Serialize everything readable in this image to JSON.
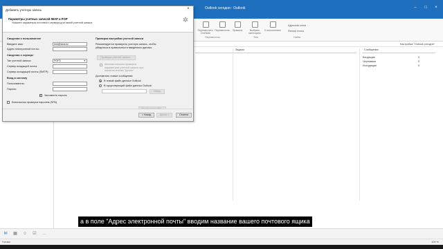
{
  "outlook": {
    "title": "Outlook сегодня - Outlook",
    "ribbon": {
      "items": [
        "Переместить: OneNote",
        "Правила",
        "Переместить",
        "Выбрать категорию",
        "К исполнению"
      ],
      "small": [
        "Адресная книга",
        "Фильтр почты"
      ],
      "groups": [
        "Переместить",
        "Теги",
        "Найти"
      ]
    },
    "subbar_right": "Настройка \"Outlook сегодня\"",
    "columns": {
      "tasks": "Задачи",
      "messages": "Сообщения"
    },
    "folders": [
      {
        "name": "Входящие",
        "count": "0"
      },
      {
        "name": "Черновики",
        "count": "0"
      },
      {
        "name": "Исходящие",
        "count": "0"
      }
    ],
    "status": {
      "left": "Готово",
      "right": "100 %"
    }
  },
  "dialog": {
    "title": "Добавить учетную запись",
    "header_title": "Параметры учетных записей IMAP и POP",
    "header_subtitle": "Укажите параметры почтового сервера для своей учетной записи.",
    "user_section": "Сведения о пользователе",
    "your_name_label": "Введите имя:",
    "your_name_value": "test@skra.kz",
    "email_label": "Адрес электронной почты:",
    "email_value": "",
    "server_section": "Сведения о сервере",
    "account_type_label": "Тип учетной записи:",
    "account_type_value": "POP3",
    "incoming_label": "Сервер входящей почты:",
    "outgoing_label": "Сервер исходящей почты (SMTP):",
    "login_section": "Вход в систему",
    "user_label": "Пользователь:",
    "password_label": "Пароль:",
    "remember_label": "Запомнить пароль",
    "remember_checked": true,
    "spa_label": "Безопасная проверка паролем (SPA)",
    "spa_checked": false,
    "test_section": "Проверка настройки учетной записи",
    "test_desc": "Рекомендуется проверить учетную запись, чтобы убедиться в правильности введенных данных.",
    "test_button": "Проверка учетной записи...",
    "auto_test_label": "Автоматическая проверка параметров учетной записи при нажатии кнопки \"Далее\"",
    "deliver_section": "Доставлять новые сообщения:",
    "new_file_label": "В новый файл данных Outlook",
    "existing_file_label": "В существующий файл данных Outlook",
    "browse_button": "Обзор",
    "more_settings_button": "Другие настройки...",
    "back_button": "< Назад",
    "next_button": "Далее >",
    "cancel_button": "Отмена"
  },
  "subtitle": "а в поле \"Адрес электронной почты\" вводим название вашего почтового ящика"
}
